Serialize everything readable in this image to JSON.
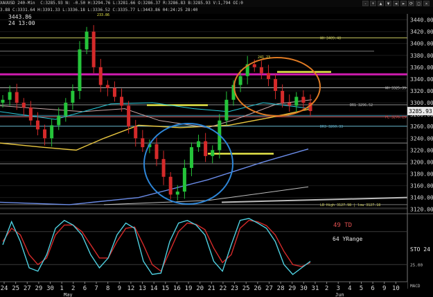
{
  "header": {
    "line1_left": "XAUUSD 240-Min",
    "line1_quote": "C:3285.93 N: -0.50 H:3294.76 L:3281.66 O:3286.37 R:3286.83 B:3285.93 V:1,794 OI:0",
    "line2": "3.88 C:3331.64 H:3391.33 L:3336.18 L:3336.52 C:3335.77 L:3443.86 04:24:25 28:40"
  },
  "crosshair_readout": {
    "price": "3443.86",
    "time": "24 13:00"
  },
  "toolbar_buttons": [
    "-",
    "+",
    "▲",
    "▼",
    "◄",
    "►",
    "⟳",
    "□",
    "✕"
  ],
  "price_axis": {
    "labels": [
      "3440.00",
      "3420.00",
      "3400.00",
      "3380.00",
      "3360.00",
      "3340.00",
      "3320.00",
      "3300.00",
      "3280.00",
      "3260.00",
      "3240.00",
      "3220.00",
      "3200.00",
      "3180.00",
      "3160.00",
      "3140.00",
      "3120.00"
    ],
    "current_price": "3285.93"
  },
  "level_labels": {
    "wh_high": "WH 3409.48",
    "wh": "WH 3325.39",
    "dr1": "DR1 3296.52",
    "pl": "PL 3276.19",
    "dr3": "DR3 3260.33",
    "lb_high": "LB High 3127.98 | low 3127.18",
    "peak": "233.86",
    "top2": "241.23"
  },
  "stoch_panel": {
    "label_td": "49 TD",
    "label_yrange": "64 YRange",
    "label_sto": "STO 24",
    "level_25": "25.00",
    "level_macd": "MACD"
  },
  "time_axis": {
    "ticks": [
      "24",
      "25",
      "27",
      "29",
      "30",
      "1",
      "2",
      "6",
      "7",
      "8",
      "9",
      "12",
      "13",
      "14",
      "15",
      "16",
      "19",
      "20",
      "21",
      "22",
      "23",
      "25",
      "26",
      "27",
      "28",
      "29",
      "30",
      "31",
      "2",
      "3",
      "4",
      "5",
      "6",
      "9",
      "10"
    ],
    "month_may": "May",
    "month_jun": "Jun"
  },
  "chart_data": {
    "type": "candlestick",
    "instrument": "XAUUSD",
    "interval": "240-Min",
    "ylim": [
      3115,
      3450
    ],
    "last_price": 3285.93,
    "series": [
      {
        "name": "price_close",
        "values": [
          3305,
          3318,
          3300,
          3292,
          3270,
          3255,
          3240,
          3262,
          3278,
          3300,
          3320,
          3390,
          3420,
          3360,
          3330,
          3325,
          3310,
          3295,
          3260,
          3240,
          3225,
          3230,
          3205,
          3175,
          3145,
          3150,
          3190,
          3225,
          3235,
          3210,
          3220,
          3270,
          3305,
          3330,
          3345,
          3365,
          3360,
          3350,
          3340,
          3320,
          3300,
          3295,
          3310,
          3300,
          3286
        ]
      }
    ],
    "stochastic": {
      "k": [
        55,
        90,
        60,
        20,
        15,
        40,
        80,
        92,
        85,
        70,
        40,
        20,
        35,
        70,
        88,
        80,
        30,
        10,
        12,
        60,
        88,
        92,
        85,
        70,
        30,
        15,
        55,
        92,
        95,
        88,
        80,
        60,
        25,
        10,
        20,
        30
      ],
      "d": [
        60,
        80,
        70,
        40,
        25,
        35,
        70,
        85,
        85,
        75,
        55,
        35,
        35,
        60,
        80,
        82,
        55,
        25,
        15,
        45,
        75,
        88,
        86,
        78,
        50,
        28,
        40,
        80,
        92,
        90,
        84,
        70,
        45,
        25,
        22,
        28
      ]
    }
  },
  "colors": {
    "background": "#000000",
    "up_candle": "#25c43a",
    "down_candle": "#d42a2a",
    "magenta_level": "#d21cb2",
    "yellow_level": "#e8e84a",
    "blue_circle": "#2e86d8",
    "orange_circle": "#e07b24",
    "cyan_ma": "#28c8d8",
    "blue_ma": "#6b8ce8",
    "stoch_cyan": "#4fd0e0",
    "stoch_red": "#d42a2a"
  }
}
